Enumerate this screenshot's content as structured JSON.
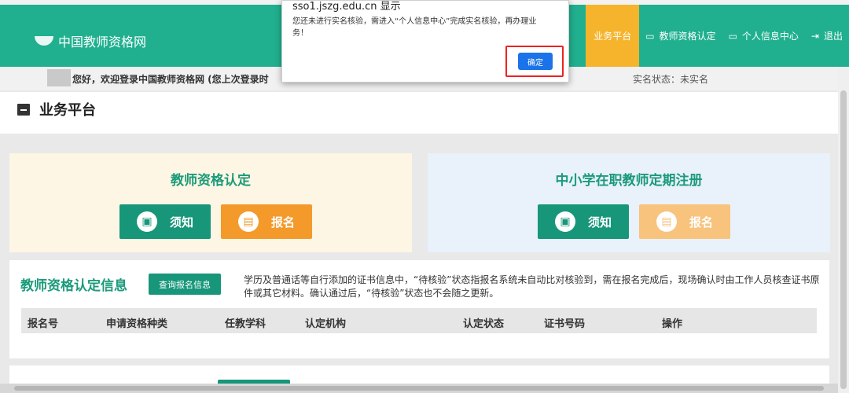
{
  "header": {
    "site_name": "中国教师资格网",
    "nav": [
      {
        "label": "业务平台",
        "icon": "",
        "active": true
      },
      {
        "label": "教师资格认定",
        "icon": "monitor-icon"
      },
      {
        "label": "个人信息中心",
        "icon": "monitor-icon"
      },
      {
        "label": "退出",
        "icon": "logout-icon"
      }
    ]
  },
  "welcome": {
    "text": "您好，欢迎登录中国教师资格网 (您上次登录时",
    "real_name_status": "实名状态：未实名"
  },
  "platform": {
    "title": "业务平台"
  },
  "panels": {
    "left": {
      "title": "教师资格认定",
      "notice_label": "须知",
      "signup_label": "报名"
    },
    "right": {
      "title": "中小学在职教师定期注册",
      "notice_label": "须知",
      "signup_label": "报名"
    }
  },
  "info": {
    "title": "教师资格认定信息",
    "query_button": "查询报名信息",
    "note": "学历及普通话等自行添加的证书信息中，“待核验”状态指报名系统未自动比对核验到，需在报名完成后，现场确认时由工作人员核查证书原件或其它材料。确认通过后，“待核验”状态也不会随之更新。",
    "columns": [
      "报名号",
      "申请资格种类",
      "任教学科",
      "认定机构",
      "认定状态",
      "证书号码",
      "操作"
    ]
  },
  "dialog": {
    "title": "sso1.jszg.edu.cn 显示",
    "message": "您还未进行实名核验，需进入“个人信息中心”完成实名核验，再办理业务！",
    "ok_label": "确定"
  },
  "colors": {
    "header_bg": "#20b08f",
    "accent_green": "#17967a",
    "accent_orange": "#f39a2b",
    "active_nav": "#f5b42c",
    "highlight_red": "#e22222"
  }
}
